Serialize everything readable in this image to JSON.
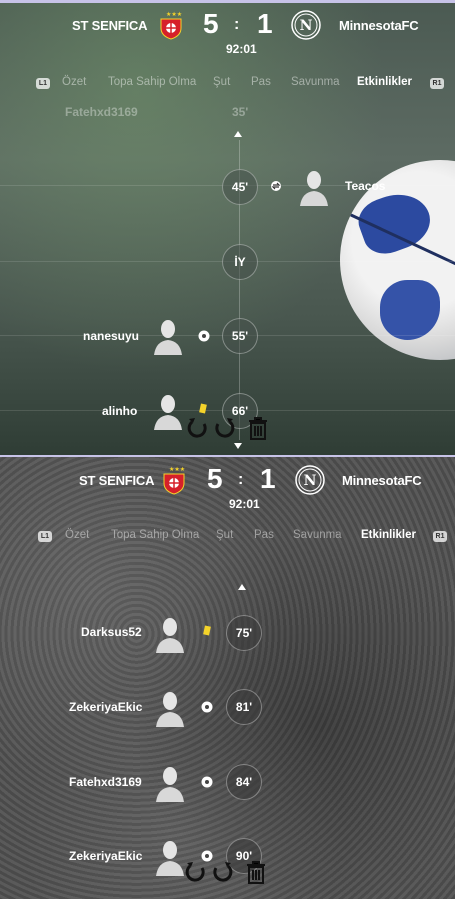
{
  "screen_1": {
    "match": {
      "home_team": "ST SENFICA",
      "away_team": "MinnesotaFC",
      "home_score": "5",
      "separator": ":",
      "away_score": "1",
      "clock": "92:01",
      "away_crest_letter": "N"
    },
    "tabs": {
      "left_badge": "L1",
      "right_badge": "R1",
      "items": [
        "Özet",
        "Topa Sahip Olma",
        "Şut",
        "Pas",
        "Savunma",
        "Etkinlikler"
      ],
      "active": "Etkinlikler"
    },
    "faded_event": {
      "player": "Fatehxd3169",
      "minute": "35'"
    },
    "events": [
      {
        "minute": "45'",
        "player": "Teacos",
        "side": "away",
        "icon": "substitution-icon"
      },
      {
        "minute": "İY",
        "player": "",
        "side": "none",
        "icon": ""
      },
      {
        "minute": "55'",
        "player": "nanesuyu",
        "side": "home",
        "icon": "ball-icon"
      },
      {
        "minute": "66'",
        "player": "alinho",
        "side": "home",
        "icon": "yellow-card-icon"
      }
    ]
  },
  "screen_2": {
    "match": {
      "home_team": "ST SENFICA",
      "away_team": "MinnesotaFC",
      "home_score": "5",
      "separator": ":",
      "away_score": "1",
      "clock": "92:01",
      "away_crest_letter": "N"
    },
    "tabs": {
      "left_badge": "L1",
      "right_badge": "R1",
      "items": [
        "Özet",
        "Topa Sahip Olma",
        "Şut",
        "Pas",
        "Savunma",
        "Etkinlikler"
      ],
      "active": "Etkinlikler"
    },
    "events": [
      {
        "minute": "75'",
        "player": "Darksus52",
        "side": "home",
        "icon": "yellow-card-icon"
      },
      {
        "minute": "81'",
        "player": "ZekeriyaEkic",
        "side": "home",
        "icon": "ball-icon"
      },
      {
        "minute": "84'",
        "player": "Fatehxd3169",
        "side": "home",
        "icon": "ball-icon"
      },
      {
        "minute": "90'",
        "player": "ZekeriyaEkic",
        "side": "home",
        "icon": "ball-icon"
      }
    ]
  },
  "colors": {
    "yellow_card": "#f4d32a",
    "ball_blue": "#2c4aa0",
    "divider": "#c7c3e8"
  }
}
